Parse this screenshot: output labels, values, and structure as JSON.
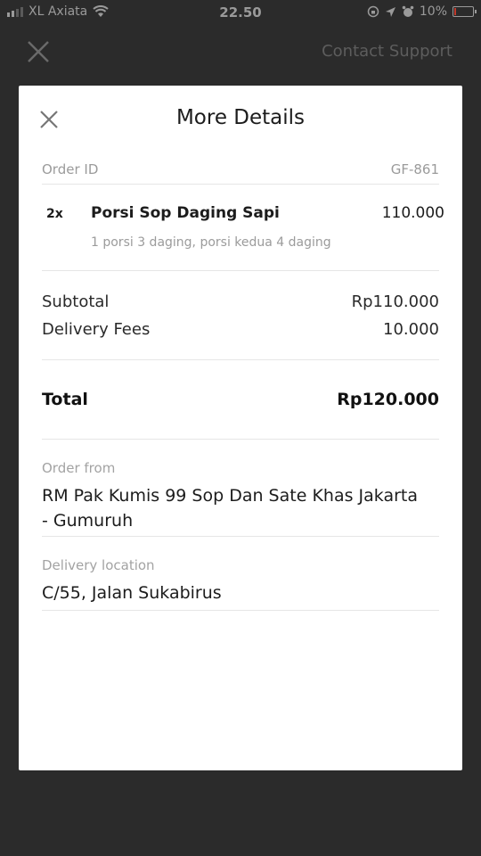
{
  "status_bar": {
    "carrier": "XL Axiata",
    "time": "22.50",
    "battery": "10%",
    "battery_level": 0.1
  },
  "header": {
    "contact_support": "Contact Support"
  },
  "modal": {
    "title": "More Details",
    "order_id_label": "Order ID",
    "order_id_value": "GF-861",
    "items": [
      {
        "qty": "2x",
        "name": "Porsi Sop Daging Sapi",
        "price": "110.000",
        "note": "1 porsi 3 daging, porsi kedua 4 daging"
      }
    ],
    "subtotal_label": "Subtotal",
    "subtotal_value": "Rp110.000",
    "delivery_fees_label": "Delivery Fees",
    "delivery_fees_value": "10.000",
    "total_label": "Total",
    "total_value": "Rp120.000",
    "order_from_label": "Order from",
    "order_from_value": "RM Pak Kumis 99 Sop Dan Sate Khas Jakarta - Gumuruh",
    "delivery_location_label": "Delivery location",
    "delivery_location_value": "C/55, Jalan Sukabirus"
  },
  "icons": {
    "close": "close-icon",
    "wifi": "wifi-icon",
    "location": "location-arrow-icon",
    "alarm": "alarm-icon",
    "lock_rotation": "rotation-lock-icon",
    "battery": "battery-icon"
  },
  "colors": {
    "background": "#2b2b2b",
    "modal": "#ffffff",
    "muted_text": "#9b9b9b",
    "battery_low": "#c0392b"
  }
}
